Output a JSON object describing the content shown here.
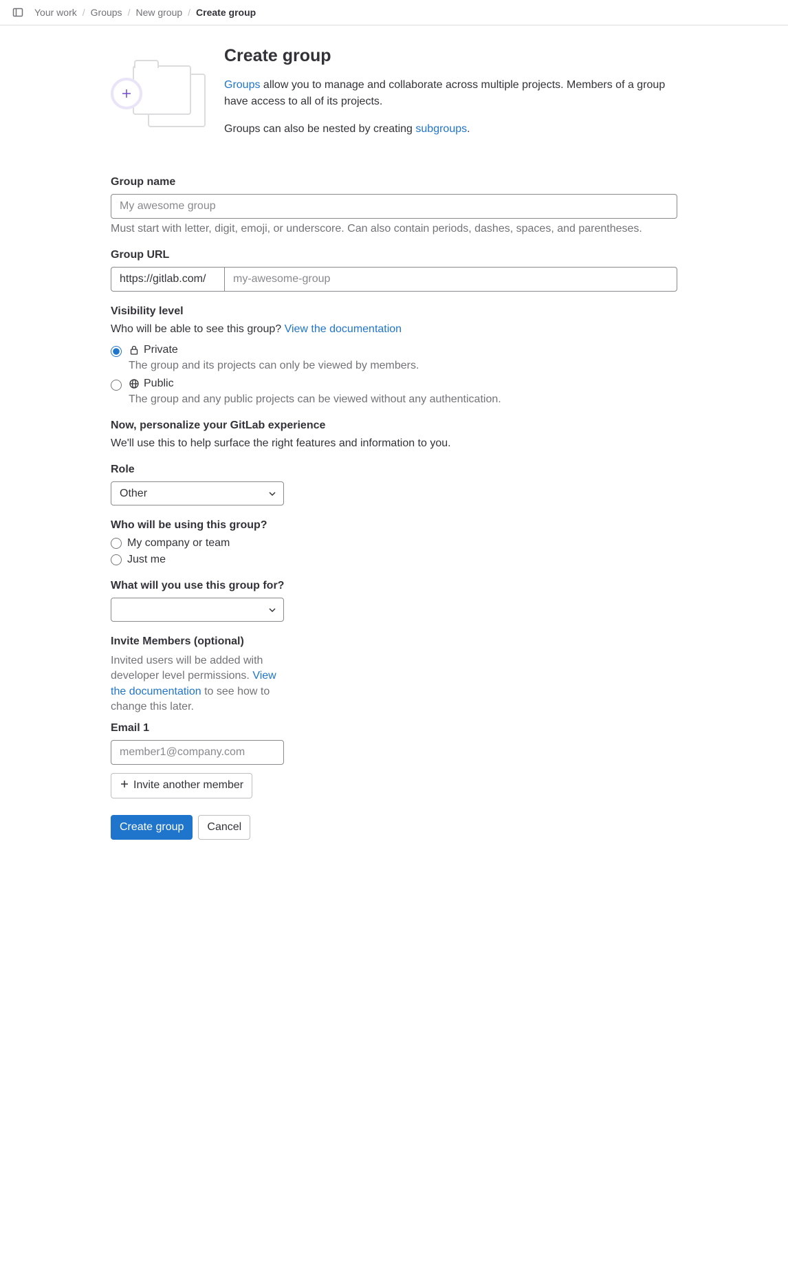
{
  "breadcrumb": {
    "items": [
      "Your work",
      "Groups",
      "New group"
    ],
    "current": "Create group"
  },
  "header": {
    "title": "Create group",
    "intro1_prefix_link": "Groups",
    "intro1_rest": " allow you to manage and collaborate across multiple projects. Members of a group have access to all of its projects.",
    "intro2_prefix": "Groups can also be nested by creating ",
    "intro2_link": "subgroups",
    "intro2_suffix": "."
  },
  "group_name": {
    "label": "Group name",
    "placeholder": "My awesome group",
    "help": "Must start with letter, digit, emoji, or underscore. Can also contain periods, dashes, spaces, and parentheses."
  },
  "group_url": {
    "label": "Group URL",
    "prefix": "https://gitlab.com/",
    "placeholder": "my-awesome-group"
  },
  "visibility": {
    "label": "Visibility level",
    "sub_prefix": "Who will be able to see this group? ",
    "sub_link": "View the documentation",
    "private_label": "Private",
    "private_desc": "The group and its projects can only be viewed by members.",
    "public_label": "Public",
    "public_desc": "The group and any public projects can be viewed without any authentication."
  },
  "personalize": {
    "heading": "Now, personalize your GitLab experience",
    "sub": "We'll use this to help surface the right features and information to you."
  },
  "role": {
    "label": "Role",
    "selected": "Other"
  },
  "who_using": {
    "label": "Who will be using this group?",
    "opt1": "My company or team",
    "opt2": "Just me"
  },
  "use_for": {
    "label": "What will you use this group for?"
  },
  "invite": {
    "heading": "Invite Members (optional)",
    "help_p1": "Invited users will be added with developer level permissions. ",
    "help_link": "View the documentation",
    "help_p2": " to see how to change this later.",
    "email1_label": "Email 1",
    "email1_placeholder": "member1@company.com",
    "add_btn": "Invite another member"
  },
  "actions": {
    "create": "Create group",
    "cancel": "Cancel"
  }
}
